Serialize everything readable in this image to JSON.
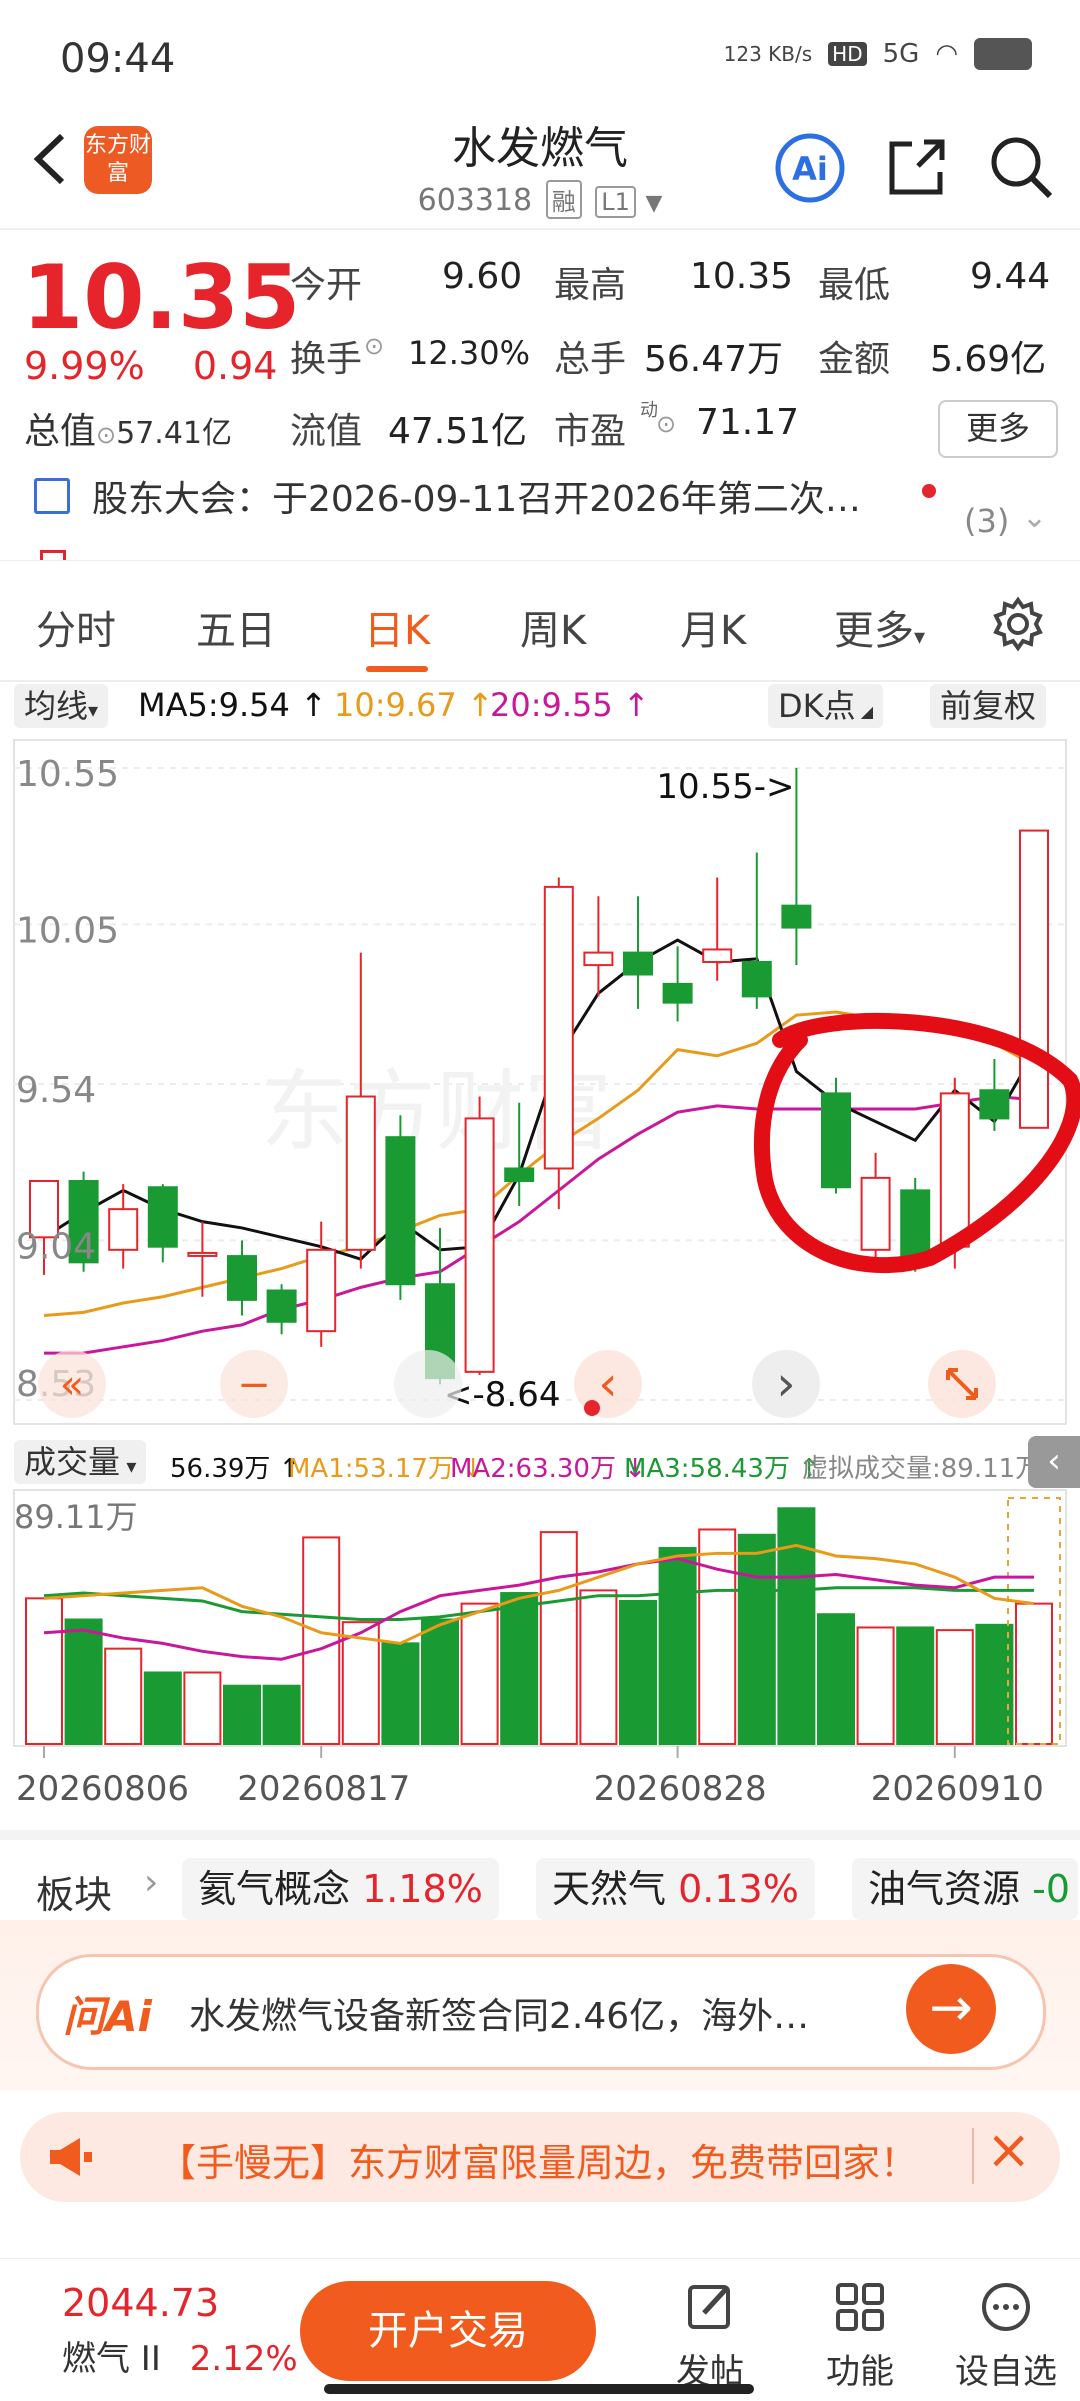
{
  "status_bar": {
    "time": "09:44",
    "net_speed": "123 KB/s",
    "hd": "HD",
    "signal": "5G"
  },
  "header": {
    "brand_text": "东方财富",
    "title": "水发燃气",
    "code": "603318",
    "tag_rong": "融",
    "tag_level": "L1",
    "ai_label": "Ai"
  },
  "quote": {
    "price": "10.35",
    "change_pct": "9.99%",
    "change": "0.94",
    "open_label": "今开",
    "open": "9.60",
    "high_label": "最高",
    "high": "10.35",
    "low_label": "最低",
    "low": "9.44",
    "turnover_label": "换手",
    "turnover": "12.30%",
    "volume_label": "总手",
    "volume": "56.47万",
    "amount_label": "金额",
    "amount": "5.69亿",
    "mcap_label": "总值",
    "mcap": "57.41亿",
    "float_label": "流值",
    "float": "47.51亿",
    "pe_label": "市盈",
    "pe_sup": "动",
    "pe": "71.17",
    "more_label": "更多"
  },
  "news": {
    "text": "股东大会：于2026-09-11召开2026年第二次…",
    "count": "(3)"
  },
  "tabs": [
    "分时",
    "五日",
    "日K",
    "周K",
    "月K",
    "更多",
    ""
  ],
  "ma_legend": {
    "selector": "均线",
    "ma5": "MA5:9.54 ↑",
    "ma10": "10:9.67 ↑",
    "ma20": "20:9.55 ↑",
    "dk": "DK点",
    "adjust": "前复权",
    "colors": {
      "ma5": "#111111",
      "ma10": "#e89a1a",
      "ma20": "#c8179b"
    }
  },
  "vol_legend": {
    "selector": "成交量",
    "v": "56.39万 ↑",
    "ma1": "MA1:53.17万 ↓",
    "ma2": "MA2:63.30万 ↓",
    "ma3": "MA3:58.43万 ↑",
    "virtual": "虚拟成交量:89.11万",
    "colors": {
      "ma1": "#e89a1a",
      "ma2": "#c8179b",
      "ma3": "#1a9a33"
    }
  },
  "chart_data": {
    "type": "candlestick",
    "y_ticks": [
      "10.55",
      "10.05",
      "9.54",
      "9.04",
      "8.53"
    ],
    "ylim": [
      8.53,
      10.55
    ],
    "annotations": {
      "high": "10.55->",
      "low": "<-8.64"
    },
    "candles": [
      {
        "o": 9.05,
        "c": 9.23,
        "h": 9.23,
        "l": 8.93
      },
      {
        "o": 9.23,
        "c": 8.97,
        "h": 9.26,
        "l": 8.94
      },
      {
        "o": 9.01,
        "c": 9.14,
        "h": 9.22,
        "l": 8.95
      },
      {
        "o": 9.21,
        "c": 9.02,
        "h": 9.22,
        "l": 8.97
      },
      {
        "o": 9.0,
        "c": 9.0,
        "h": 9.1,
        "l": 8.86
      },
      {
        "o": 8.99,
        "c": 8.85,
        "h": 9.04,
        "l": 8.8
      },
      {
        "o": 8.88,
        "c": 8.78,
        "h": 8.9,
        "l": 8.74
      },
      {
        "o": 8.75,
        "c": 9.01,
        "h": 9.1,
        "l": 8.7
      },
      {
        "o": 9.01,
        "c": 9.5,
        "h": 9.96,
        "l": 8.95
      },
      {
        "o": 9.37,
        "c": 8.9,
        "h": 9.44,
        "l": 8.85
      },
      {
        "o": 8.9,
        "c": 8.6,
        "h": 9.08,
        "l": 8.58
      },
      {
        "o": 8.62,
        "c": 9.43,
        "h": 9.5,
        "l": 8.61
      },
      {
        "o": 9.27,
        "c": 9.23,
        "h": 9.48,
        "l": 9.15
      },
      {
        "o": 9.27,
        "c": 10.17,
        "h": 10.2,
        "l": 9.14
      },
      {
        "o": 9.92,
        "c": 9.96,
        "h": 10.14,
        "l": 9.82
      },
      {
        "o": 9.96,
        "c": 9.89,
        "h": 10.14,
        "l": 9.78
      },
      {
        "o": 9.86,
        "c": 9.8,
        "h": 9.98,
        "l": 9.74
      },
      {
        "o": 9.93,
        "c": 9.97,
        "h": 10.2,
        "l": 9.87
      },
      {
        "o": 9.93,
        "c": 9.82,
        "h": 10.28,
        "l": 9.78
      },
      {
        "o": 10.11,
        "c": 10.04,
        "h": 10.55,
        "l": 9.92
      },
      {
        "o": 9.51,
        "c": 9.21,
        "h": 9.56,
        "l": 9.19
      },
      {
        "o": 9.01,
        "c": 9.24,
        "h": 9.32,
        "l": 8.94
      },
      {
        "o": 9.2,
        "c": 8.99,
        "h": 9.24,
        "l": 8.94
      },
      {
        "o": 9.02,
        "c": 9.51,
        "h": 9.56,
        "l": 8.95
      },
      {
        "o": 9.52,
        "c": 9.43,
        "h": 9.62,
        "l": 9.39
      },
      {
        "o": 9.4,
        "c": 10.35,
        "h": 10.35,
        "l": 9.44
      }
    ],
    "ma5": [
      9.05,
      9.13,
      9.2,
      9.14,
      9.1,
      9.08,
      9.05,
      9.02,
      8.98,
      9.1,
      9.01,
      9.02,
      9.25,
      9.63,
      9.83,
      9.93,
      10.0,
      9.93,
      9.94,
      9.58,
      9.48,
      9.42,
      9.36,
      9.52,
      9.42,
      9.64
    ],
    "ma10": [
      8.8,
      8.81,
      8.84,
      8.86,
      8.89,
      8.92,
      8.95,
      8.99,
      9.02,
      9.07,
      9.12,
      9.14,
      9.25,
      9.35,
      9.43,
      9.52,
      9.65,
      9.63,
      9.67,
      9.76,
      9.77,
      9.75,
      9.75,
      9.71,
      9.67,
      9.6
    ],
    "ma20": [
      8.68,
      8.68,
      8.7,
      8.72,
      8.75,
      8.77,
      8.82,
      8.85,
      8.89,
      8.92,
      8.94,
      9.02,
      9.1,
      9.2,
      9.3,
      9.38,
      9.45,
      9.47,
      9.46,
      9.46,
      9.46,
      9.46,
      9.46,
      9.48,
      9.5,
      9.49
    ],
    "volume": {
      "max_label": "89.11万",
      "ylim": [
        0,
        89.11
      ],
      "values": [
        55,
        47,
        36,
        27,
        27,
        22,
        22,
        78,
        46,
        38,
        47,
        53,
        57,
        80,
        58,
        54,
        74,
        81,
        79,
        89,
        49,
        44,
        44,
        43,
        45,
        53
      ],
      "ma1": [
        55,
        56,
        57,
        58,
        59,
        52,
        48,
        42,
        40,
        38,
        45,
        50,
        55,
        58,
        63,
        68,
        71,
        72,
        72,
        75,
        71,
        70,
        68,
        63,
        55,
        53
      ],
      "ma2": [
        42,
        43,
        40,
        38,
        35,
        33,
        32,
        36,
        42,
        50,
        56,
        58,
        60,
        63,
        65,
        68,
        70,
        66,
        63,
        63,
        64,
        62,
        60,
        59,
        63,
        63
      ],
      "ma3": [
        56,
        57,
        56,
        55,
        54,
        50,
        49,
        48,
        47,
        47,
        48,
        50,
        52,
        54,
        56,
        56,
        57,
        58,
        58,
        58,
        59,
        59,
        59,
        58,
        58,
        58
      ]
    },
    "x_labels": [
      {
        "index": 0,
        "label": "20260806"
      },
      {
        "index": 7,
        "label": "20260817"
      },
      {
        "index": 16,
        "label": "20260828"
      },
      {
        "index": 23,
        "label": "20260910"
      }
    ]
  },
  "chart_controls": {
    "back": "«",
    "minus": "−",
    "prev": "‹",
    "next": "›"
  },
  "sector": {
    "label": "板块",
    "items": [
      {
        "name": "氦气概念",
        "pct": "1.18%"
      },
      {
        "name": "天然气",
        "pct": "0.13%"
      },
      {
        "name": "油气资源",
        "pct": "-0"
      }
    ]
  },
  "ai_bar": {
    "logo": "问Ai",
    "text": "水发燃气设备新签合同2.46亿，海外…"
  },
  "promo": {
    "text": "【手慢无】东方财富限量周边，免费带回家！"
  },
  "bottom_bar": {
    "index_value": "2044.73",
    "index_name": "燃气 II",
    "index_pct": "2.12%",
    "trade_label": "开户交易",
    "nav": [
      "发帖",
      "功能",
      "设自选"
    ]
  }
}
